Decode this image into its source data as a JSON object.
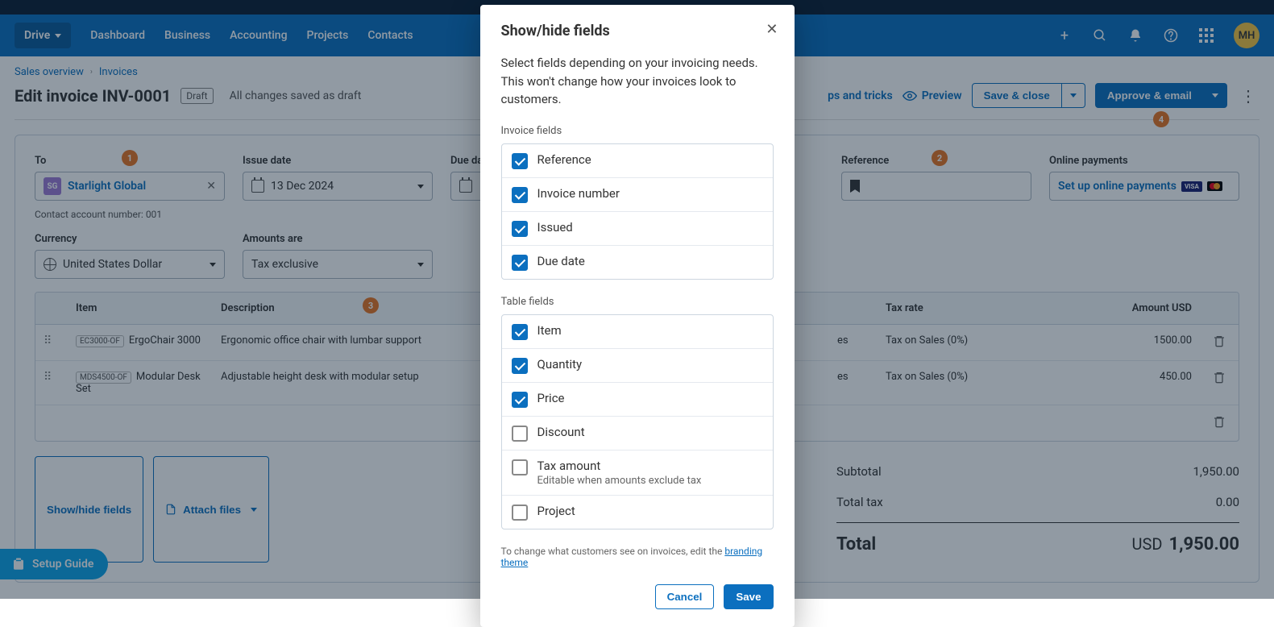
{
  "nav": {
    "org": "Drive",
    "items": [
      "Dashboard",
      "Business",
      "Accounting",
      "Projects",
      "Contacts"
    ],
    "avatar": "MH"
  },
  "breadcrumb": {
    "parent": "Sales overview",
    "current": "Invoices"
  },
  "page": {
    "title": "Edit invoice INV-0001",
    "status": "Draft",
    "saved": "All changes saved as draft",
    "tips": "ps and tricks",
    "preview": "Preview",
    "saveClose": "Save & close",
    "approveEmail": "Approve & email"
  },
  "fields": {
    "to": {
      "label": "To",
      "chip": "SG",
      "name": "Starlight Global",
      "sub": "Contact account number: 001"
    },
    "issue": {
      "label": "Issue date",
      "value": "13 Dec 2024"
    },
    "due": {
      "label": "Due date"
    },
    "reference": {
      "label": "Reference"
    },
    "online": {
      "label": "Online payments",
      "link": "Set up online payments"
    },
    "currency": {
      "label": "Currency",
      "value": "United States Dollar"
    },
    "amounts": {
      "label": "Amounts are",
      "value": "Tax exclusive"
    }
  },
  "table": {
    "headers": {
      "item": "Item",
      "desc": "Description",
      "tax": "Tax rate",
      "amount": "Amount USD"
    },
    "rows": [
      {
        "sku": "EC3000-OF",
        "name": "ErgoChair 3000",
        "desc": "Ergonomic office chair with lumbar support",
        "tax": "Tax on Sales (0%)",
        "amount": "1500.00",
        "taxTail": "es"
      },
      {
        "sku": "MDS4500-OF",
        "name": "Modular Desk Set",
        "desc": "Adjustable height desk with modular setup",
        "tax": "Tax on Sales (0%)",
        "amount": "450.00",
        "taxTail": "es"
      }
    ]
  },
  "belowTable": {
    "showHide": "Show/hide fields",
    "attach": "Attach files"
  },
  "totals": {
    "subtotalLabel": "Subtotal",
    "subtotal": "1,950.00",
    "taxLabel": "Total tax",
    "tax": "0.00",
    "totalLabel": "Total",
    "currency": "USD",
    "total": "1,950.00"
  },
  "setupGuide": "Setup Guide",
  "modal": {
    "title": "Show/hide fields",
    "desc": "Select fields depending on your invoicing needs. This won't change how your invoices look to customers.",
    "invoiceFieldsLabel": "Invoice fields",
    "invoiceFields": [
      {
        "label": "Reference",
        "checked": true
      },
      {
        "label": "Invoice number",
        "checked": true
      },
      {
        "label": "Issued",
        "checked": true
      },
      {
        "label": "Due date",
        "checked": true
      }
    ],
    "tableFieldsLabel": "Table fields",
    "tableFields": [
      {
        "label": "Item",
        "checked": true
      },
      {
        "label": "Quantity",
        "checked": true
      },
      {
        "label": "Price",
        "checked": true
      },
      {
        "label": "Discount",
        "checked": false
      },
      {
        "label": "Tax amount",
        "checked": false,
        "sub": "Editable when amounts exclude tax"
      },
      {
        "label": "Project",
        "checked": false
      }
    ],
    "note": "To change what customers see on invoices, edit the ",
    "noteLink": "branding theme",
    "cancel": "Cancel",
    "save": "Save"
  },
  "badges": {
    "one": "1",
    "two": "2",
    "three": "3",
    "four": "4"
  }
}
